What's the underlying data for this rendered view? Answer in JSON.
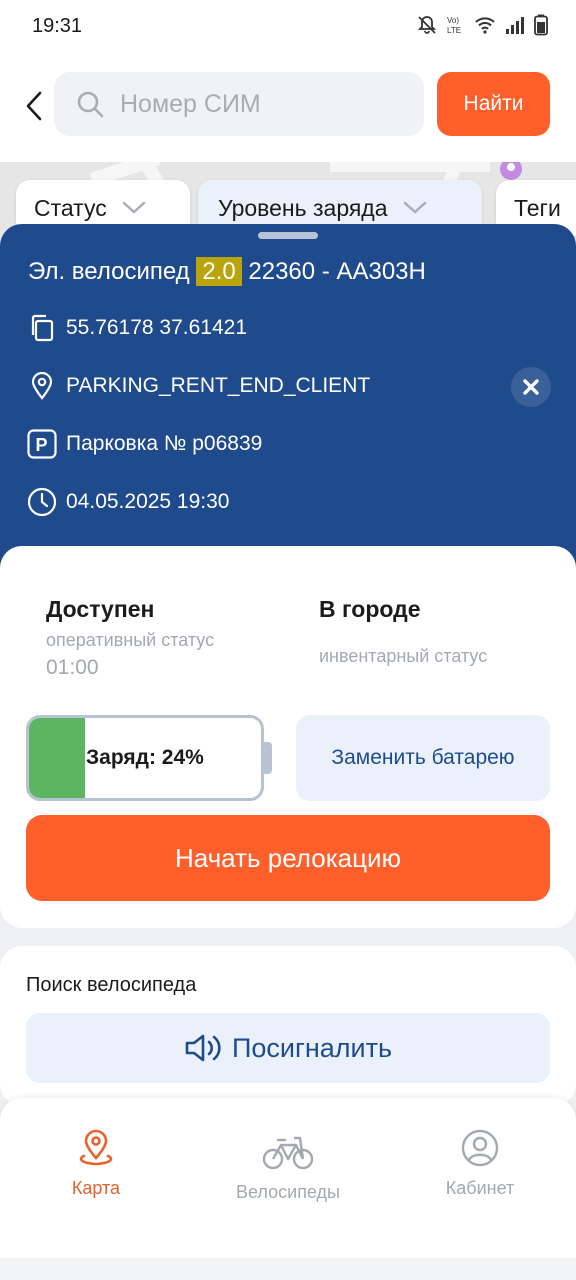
{
  "status_bar": {
    "time": "19:31",
    "icons": [
      "bell-muted-icon",
      "volte-icon",
      "wifi-icon",
      "signal-icon",
      "battery-icon"
    ]
  },
  "search": {
    "placeholder": "Номер СИМ",
    "button_label": "Найти"
  },
  "filters": [
    {
      "label": "Статус"
    },
    {
      "label": "Уровень заряда"
    },
    {
      "label": "Теги"
    }
  ],
  "vehicle": {
    "title_prefix": "Эл. велосипед",
    "model_badge": "2.0",
    "title_suffix": "22360 - АА303Н",
    "coordinates": "55.76178 37.61421",
    "location": "PARKING_RENT_END_CLIENT",
    "parking": "Парковка № p06839",
    "timestamp": "04.05.2025 19:30"
  },
  "status": {
    "operational": {
      "value": "Доступен",
      "label": "оперативный статус",
      "time": "01:00"
    },
    "inventory": {
      "value": "В городе",
      "label": "инвентарный статус"
    }
  },
  "battery": {
    "label": "Заряд: 24%",
    "level_percent": 24,
    "replace_label": "Заменить батарею"
  },
  "actions": {
    "relocation_label": "Начать релокацию"
  },
  "bike_search": {
    "title": "Поиск велосипеда",
    "signal_label": "Посигналить"
  },
  "nav": {
    "items": [
      {
        "label": "Карта",
        "icon": "map-pin-icon",
        "active": true
      },
      {
        "label": "Велосипеды",
        "icon": "bicycle-icon",
        "active": false
      },
      {
        "label": "Кабинет",
        "icon": "profile-icon",
        "active": false
      }
    ]
  },
  "colors": {
    "accent": "#ff5f2b",
    "primary_blue": "#1f4b8d",
    "battery_green": "#5db461",
    "badge_yellow": "#b9a40b"
  }
}
